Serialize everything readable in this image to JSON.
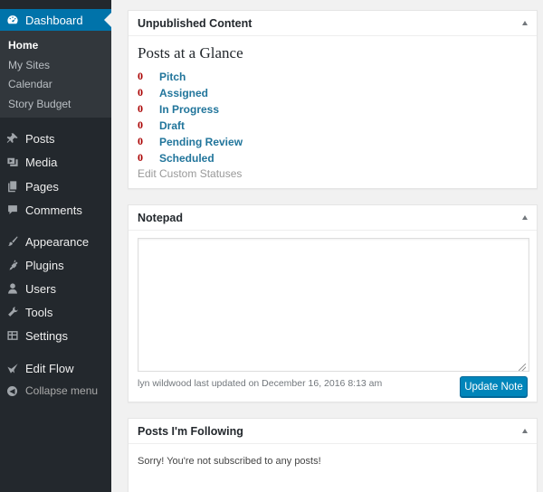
{
  "sidebar": {
    "dashboard": {
      "label": "Dashboard",
      "icon": "dashboard-icon"
    },
    "submenu": [
      "Home",
      "My Sites",
      "Calendar",
      "Story Budget"
    ],
    "items": [
      {
        "label": "Posts",
        "icon": "pin-icon"
      },
      {
        "label": "Media",
        "icon": "media-icon"
      },
      {
        "label": "Pages",
        "icon": "pages-icon"
      },
      {
        "label": "Comments",
        "icon": "comment-icon"
      },
      {
        "label": "Appearance",
        "icon": "paintbrush-icon"
      },
      {
        "label": "Plugins",
        "icon": "plug-icon"
      },
      {
        "label": "Users",
        "icon": "user-icon"
      },
      {
        "label": "Tools",
        "icon": "wrench-icon"
      },
      {
        "label": "Settings",
        "icon": "settings-icon"
      },
      {
        "label": "Edit Flow",
        "icon": "edit-flow-icon"
      }
    ],
    "collapse": {
      "label": "Collapse menu",
      "icon": "collapse-icon"
    }
  },
  "unpublished": {
    "title": "Unpublished Content",
    "glance_title": "Posts at a Glance",
    "statuses": [
      {
        "count": "0",
        "label": "Pitch"
      },
      {
        "count": "0",
        "label": "Assigned"
      },
      {
        "count": "0",
        "label": "In Progress"
      },
      {
        "count": "0",
        "label": "Draft"
      },
      {
        "count": "0",
        "label": "Pending Review"
      },
      {
        "count": "0",
        "label": "Scheduled"
      }
    ],
    "edit_link": "Edit Custom Statuses"
  },
  "notepad": {
    "title": "Notepad",
    "note_value": "",
    "meta": "lyn wildwood last updated on December 16, 2016 8:13 am",
    "button": "Update Note"
  },
  "following": {
    "title": "Posts I'm Following",
    "message": "Sorry! You're not subscribed to any posts!"
  },
  "colors": {
    "sidebar_bg": "#23282d",
    "submenu_bg": "#32373c",
    "accent": "#0073aa",
    "link": "#21759b",
    "count": "#aa0000",
    "button": "#0085ba"
  }
}
